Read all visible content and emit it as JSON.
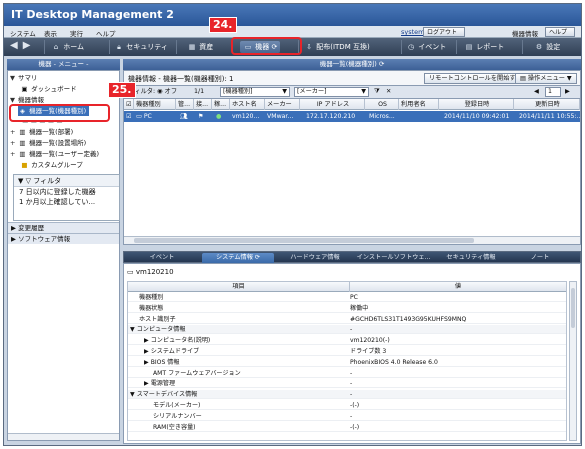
{
  "app": {
    "title": "IT Desktop Management 2"
  },
  "menubar": {
    "items": [
      "システム",
      "表示",
      "実行",
      "ヘルプ"
    ],
    "user": "system",
    "logout": "ログアウト",
    "device_info": "機器情報",
    "help": "ヘルプ"
  },
  "navbar": {
    "home": "ホーム",
    "security": "セキュリティ",
    "assets": "資産",
    "equipment": "機器",
    "distribution": "配布(ITDM 互換)",
    "events": "イベント",
    "reports": "レポート",
    "settings": "設定"
  },
  "annotations": {
    "step24": "24.",
    "step25": "25."
  },
  "left": {
    "header": "機器 - メニュー -",
    "summary": "サマリ",
    "dashboard": "ダッシュボード",
    "device_info": "機器情報",
    "device_list_type": "機器一覧(機器種別)",
    "device_list_dept": "機器一覧(部署)",
    "device_list_place": "機器一覧(設置場所)",
    "device_list_user": "機器一覧(ユーザー定義)",
    "custom_group": "カスタムグループ",
    "filter": "フィルタ",
    "filter_items": [
      "7 日以内に登録した機器",
      "1 か月以上確認してい..."
    ],
    "change_history": "変更履歴",
    "software_info": "ソフトウェア情報"
  },
  "right": {
    "header": "機器一覧(機器種別)",
    "breadcrumb": "機器情報 - 機器一覧(機器種別): 1",
    "remote_button": "リモートコントロールを開始する",
    "operation_menu": "操作メニュー",
    "filter_label": "フィルタ:",
    "filter_state": "オフ",
    "page_info": "1/1",
    "dropdown_type": "[機器種別]",
    "dropdown_maker": "[メーカー]",
    "page_num": "1",
    "columns": [
      "機器種別",
      "管...",
      "接...",
      "稼...",
      "ホスト名",
      "メーカー",
      "IP アドレス",
      "OS",
      "利用者名",
      "登録日時",
      "更新日時"
    ],
    "row": {
      "type": "PC",
      "host": "vm120...",
      "maker": "VMwar...",
      "ip": "172.17.120.210",
      "os": "Micros...",
      "user": "",
      "registered": "2014/11/10 09:42:01",
      "updated": "2014/11/11 10:55:..."
    }
  },
  "tabs": [
    "イベント",
    "システム情報",
    "ハードウェア情報",
    "インストールソフトウェ...",
    "セキュリティ情報",
    "ノート"
  ],
  "detail": {
    "device_name": "vm120210",
    "col_item": "項目",
    "col_value": "値",
    "rows": [
      {
        "k": "機器種別",
        "v": "PC",
        "indent": 1,
        "grp": false,
        "exp": ""
      },
      {
        "k": "機器状態",
        "v": "稼働中",
        "indent": 1,
        "grp": false,
        "exp": ""
      },
      {
        "k": "ホスト識別子",
        "v": "#GCHD6TLS31T1493G95KUHFS9MNQ",
        "indent": 1,
        "grp": false,
        "exp": ""
      },
      {
        "k": "コンピュータ情報",
        "v": "-",
        "indent": 0,
        "grp": true,
        "exp": "▼"
      },
      {
        "k": "コンピュータ名(説明)",
        "v": "vm120210(-)",
        "indent": 2,
        "grp": false,
        "exp": "▶"
      },
      {
        "k": "システムドライブ",
        "v": "ドライブ数 3",
        "indent": 2,
        "grp": false,
        "exp": "▶"
      },
      {
        "k": "BIOS 情報",
        "v": "PhoenixBIOS 4.0 Release 6.0",
        "indent": 2,
        "grp": false,
        "exp": "▶"
      },
      {
        "k": "AMT ファームウェアバージョン",
        "v": "-",
        "indent": 3,
        "grp": false,
        "exp": ""
      },
      {
        "k": "電源管理",
        "v": "-",
        "indent": 2,
        "grp": false,
        "exp": "▶"
      },
      {
        "k": "スマートデバイス情報",
        "v": "-",
        "indent": 0,
        "grp": true,
        "exp": "▼"
      },
      {
        "k": "モデル(メーカー)",
        "v": "-(-)",
        "indent": 3,
        "grp": false,
        "exp": ""
      },
      {
        "k": "シリアルナンバー",
        "v": "-",
        "indent": 3,
        "grp": false,
        "exp": ""
      },
      {
        "k": "RAM(空き容量)",
        "v": "-(-)",
        "indent": 3,
        "grp": false,
        "exp": ""
      }
    ]
  },
  "colors": {
    "accent": "#3a6fb9",
    "annotation": "#e8242a",
    "navbar": "#2f3f55"
  }
}
